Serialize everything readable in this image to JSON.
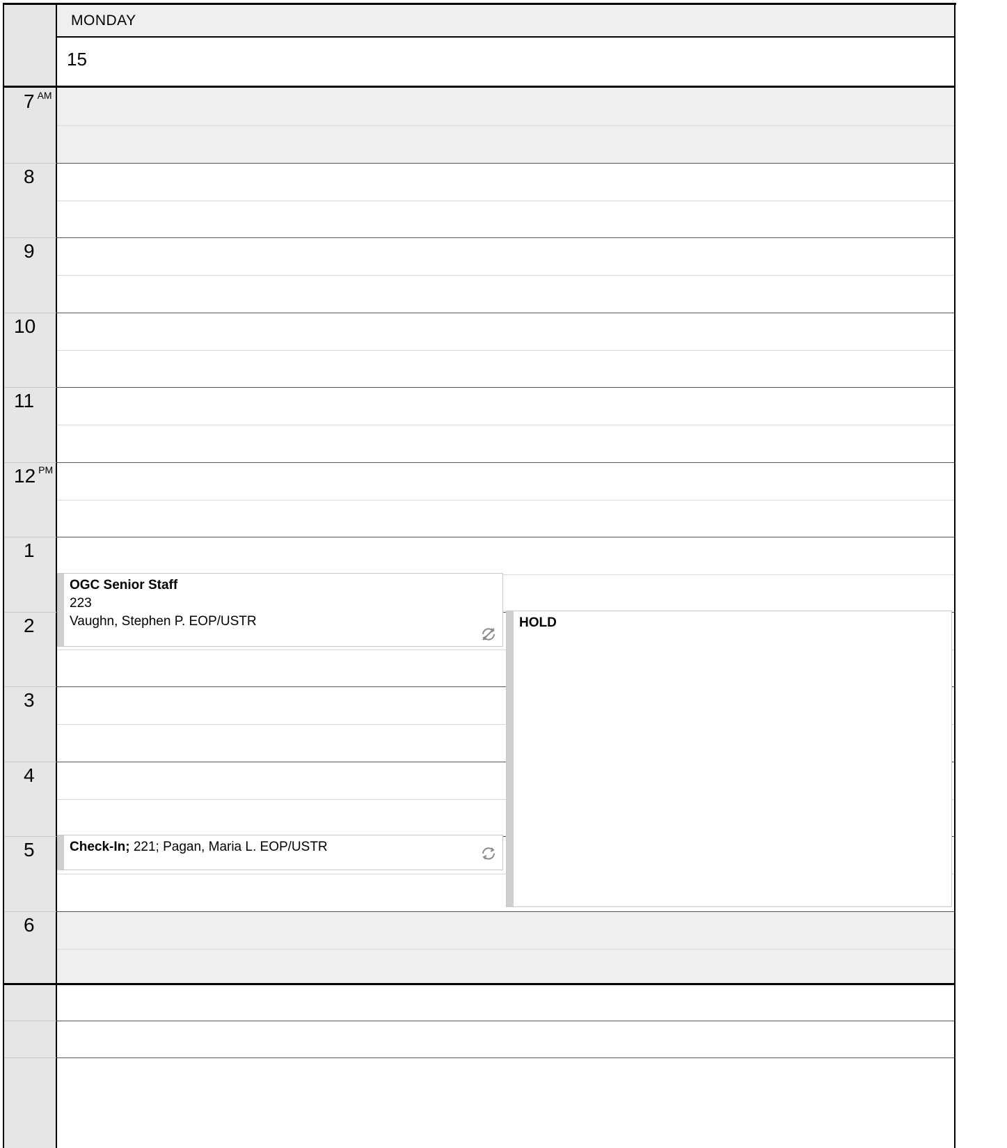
{
  "header": {
    "day_name": "MONDAY",
    "day_number": "15"
  },
  "hours": [
    {
      "label": "7",
      "suffix": "AM"
    },
    {
      "label": "8",
      "suffix": ""
    },
    {
      "label": "9",
      "suffix": ""
    },
    {
      "label": "10",
      "suffix": ""
    },
    {
      "label": "11",
      "suffix": ""
    },
    {
      "label": "12",
      "suffix": "PM"
    },
    {
      "label": "1",
      "suffix": ""
    },
    {
      "label": "2",
      "suffix": ""
    },
    {
      "label": "3",
      "suffix": ""
    },
    {
      "label": "4",
      "suffix": ""
    },
    {
      "label": "5",
      "suffix": ""
    },
    {
      "label": "6",
      "suffix": ""
    }
  ],
  "events": {
    "ogc": {
      "title": "OGC Senior Staff",
      "location": "223",
      "organizer": "Vaughn, Stephen P. EOP/USTR",
      "icon": "recurring-exception-icon"
    },
    "hold": {
      "title": "HOLD"
    },
    "checkin": {
      "title": "Check-In;",
      "details": " 221; Pagan, Maria L. EOP/USTR",
      "icon": "recurring-icon"
    }
  },
  "colors": {
    "gutter": "#e6e6e6",
    "off_hours": "#efefef",
    "event_bar": "#cfcfcf"
  }
}
